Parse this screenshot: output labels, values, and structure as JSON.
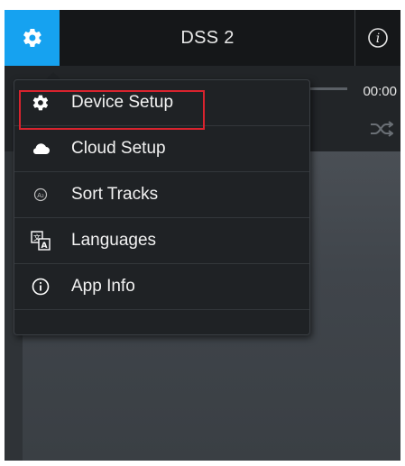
{
  "header": {
    "title": "DSS 2",
    "settings_icon": "gear-icon",
    "info_icon": "info-icon"
  },
  "player": {
    "time": "00:00",
    "shuffle_icon": "shuffle-icon"
  },
  "menu": {
    "items": [
      {
        "label": "Device Setup",
        "icon": "gear-icon",
        "selected": true
      },
      {
        "label": "Cloud Setup",
        "icon": "cloud-icon"
      },
      {
        "label": "Sort Tracks",
        "icon": "sort-icon"
      },
      {
        "label": "Languages",
        "icon": "translate-icon"
      },
      {
        "label": "App Info",
        "icon": "info-icon"
      }
    ]
  },
  "colors": {
    "accent": "#16a2f0",
    "highlight_border": "#d9232e",
    "menu_bg": "#1f2225"
  }
}
